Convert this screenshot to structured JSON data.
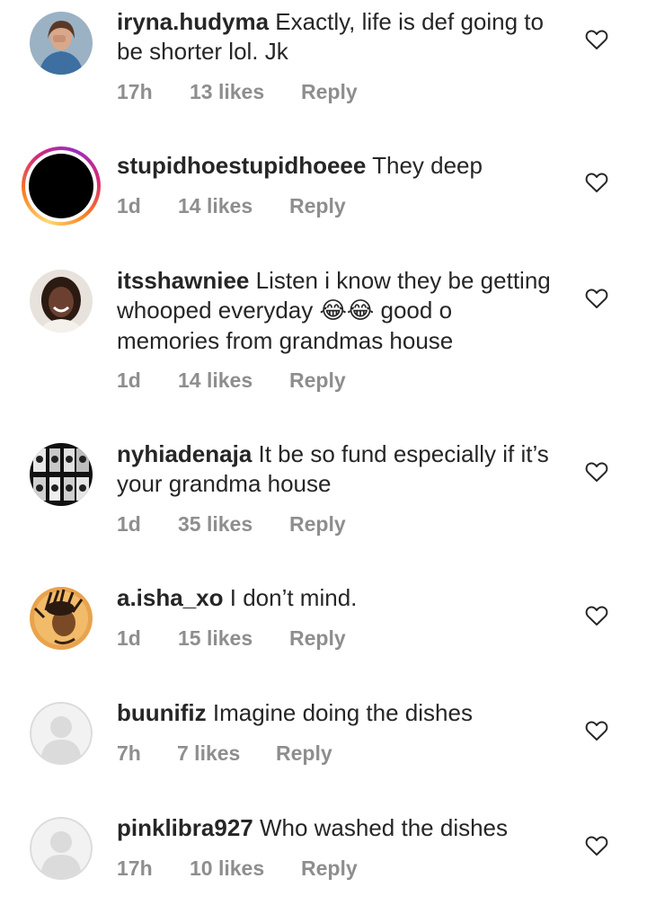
{
  "comments": [
    {
      "username": "iryna.hudyma",
      "text": "Exactly, life is def going to be shorter lol. Jk",
      "time": "17h",
      "likes": "13 likes",
      "reply": "Reply"
    },
    {
      "username": "stupidhoestupidhoeee",
      "text": "They deep",
      "time": "1d",
      "likes": "14 likes",
      "reply": "Reply"
    },
    {
      "username": "itsshawniee",
      "text_before": "Listen i know they be getting whooped everyday",
      "emoji": "😂😂",
      "text_after": "good o memories from grandmas house",
      "time": "1d",
      "likes": "14 likes",
      "reply": "Reply"
    },
    {
      "username": "nyhiadenaja",
      "text": "It be so fund especially if it’s your grandma house",
      "time": "1d",
      "likes": "35 likes",
      "reply": "Reply"
    },
    {
      "username": "a.isha_xo",
      "text": "I don’t mind.",
      "time": "1d",
      "likes": "15 likes",
      "reply": "Reply"
    },
    {
      "username": "buunifiz",
      "text": "Imagine doing the dishes",
      "time": "7h",
      "likes": "7 likes",
      "reply": "Reply"
    },
    {
      "username": "pinklibra927",
      "text": "Who washed the dishes",
      "time": "17h",
      "likes": "10 likes",
      "reply": "Reply"
    }
  ],
  "colors": {
    "text": "#262626",
    "meta": "#8e8e8e",
    "placeholder_avatar": "#dbdbdb"
  }
}
